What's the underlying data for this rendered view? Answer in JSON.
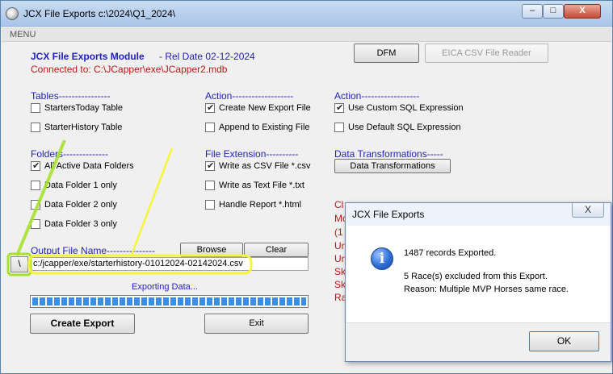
{
  "window": {
    "title": "JCX File Exports c:\\2024\\Q1_2024\\",
    "controls": {
      "minimize": "–",
      "maximize": "□",
      "close": "X"
    }
  },
  "menu": {
    "label": "MENU"
  },
  "module": {
    "title": "JCX File Exports Module",
    "rel_date": "- Rel Date 02-12-2024",
    "connected": "Connected to: C:\\JCapper\\exe\\JCapper2.mdb"
  },
  "top_buttons": {
    "dfm": "DFM",
    "eica": "EICA CSV File Reader"
  },
  "tables": {
    "heading": "Tables----------------",
    "starters_today": "StartersToday Table",
    "starter_history": "StarterHistory Table"
  },
  "action1": {
    "heading": "Action-------------------",
    "create_new": "Create New Export File",
    "append": "Append to Existing File"
  },
  "action2": {
    "heading": "Action------------------",
    "custom_sql": "Use Custom SQL Expression",
    "default_sql": "Use Default SQL Expression"
  },
  "folders": {
    "heading": "Folders--------------",
    "all_active": "All Active Data Folders",
    "folder1": "Data Folder 1 only",
    "folder2": "Data Folder 2 only",
    "folder3": "Data Folder 3 only"
  },
  "file_extension": {
    "heading": "File Extension----------",
    "csv": "Write as CSV File  *.csv",
    "txt": "Write as Text File *.txt",
    "html": "Handle Report *.html"
  },
  "data_transformations": {
    "heading": "Data Transformations-----",
    "button": "Data Transformations"
  },
  "output": {
    "heading": "Output File Name---------------",
    "browse": "Browse",
    "clear": "Clear",
    "slash": "\\",
    "path": "c:/jcapper/exe/starterhistory-01012024-02142024.csv"
  },
  "status": {
    "text": "Exporting Data...",
    "progress_fraction": 1.0
  },
  "bottom_buttons": {
    "create_export": "Create Export",
    "exit": "Exit"
  },
  "partial_red_text": [
    "Cl",
    "Mo",
    "(1",
    "Un",
    "Un",
    "Sk",
    "Sk",
    "Ra"
  ],
  "dialog": {
    "title": "JCX File Exports",
    "close": "X",
    "line1": "1487 records Exported.",
    "line2": "5 Race(s) excluded from this Export.",
    "line3": "Reason: Multiple MVP Horses same race.",
    "ok": "OK"
  },
  "colors": {
    "section_blue": "#1f1fc2",
    "error_red": "#c01515",
    "highlight_yellow": "#f5f53a",
    "highlight_green": "#a6e22e",
    "progress_blue": "#3a8ee6"
  }
}
